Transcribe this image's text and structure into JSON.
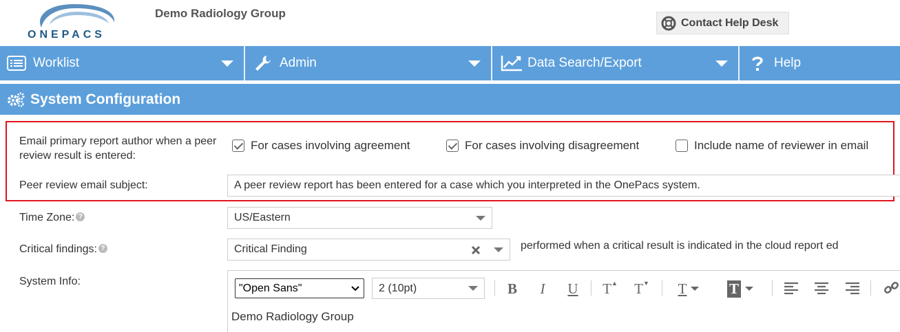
{
  "header": {
    "logo_text": "ONEPACS",
    "org_name": "Demo Radiology Group",
    "help_desk_label": "Contact Help Desk"
  },
  "nav": [
    {
      "label": "Worklist",
      "icon": "list-icon"
    },
    {
      "label": "Admin",
      "icon": "wrench-icon"
    },
    {
      "label": "Data Search/Export",
      "icon": "line-chart-icon"
    },
    {
      "label": "Help",
      "icon": "question-icon"
    }
  ],
  "page": {
    "title": "System Configuration"
  },
  "peer_review": {
    "label": "Email primary report author when a peer review result is entered:",
    "options": [
      {
        "label": "For cases involving agreement",
        "checked": true
      },
      {
        "label": "For cases involving disagreement",
        "checked": true
      },
      {
        "label": "Include name of reviewer in email",
        "checked": false
      }
    ],
    "subject_label": "Peer review email subject:",
    "subject_value": "A peer review report has been entered for a case which you interpreted in the OnePacs system."
  },
  "timezone": {
    "label": "Time Zone:",
    "value": "US/Eastern"
  },
  "critical": {
    "label": "Critical findings:",
    "value": "Critical Finding",
    "note": "performed when a critical result is indicated in the cloud report ed"
  },
  "system_info": {
    "label": "System Info:",
    "font_value": "\"Open Sans\"",
    "size_value": "2 (10pt)",
    "content": "Demo Radiology Group"
  },
  "colors": {
    "nav_bg": "#5c9fdb",
    "highlight_border": "#e0141e"
  }
}
